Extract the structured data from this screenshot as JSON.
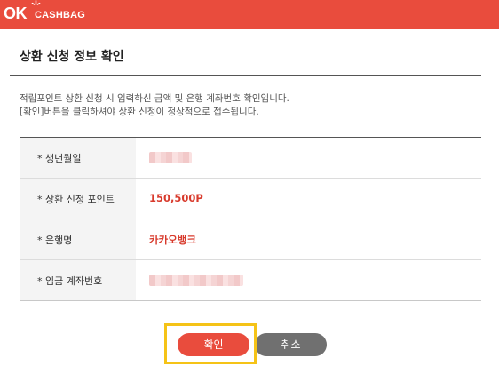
{
  "brand": {
    "ok": "OK",
    "cashbag": "CASHBAG",
    "color": "#e94c3d"
  },
  "page": {
    "title": "상환 신청 정보 확인",
    "description_line1": "적립포인트 상환 신청 시 입력하신 금액 및 은행 계좌번호 확인입니다.",
    "description_line2": "[확인]버튼을 클릭하셔야 상환 신청이 정상적으로 접수됩니다."
  },
  "rows": [
    {
      "label": "* 생년월일",
      "value": null,
      "masked": true
    },
    {
      "label": "* 상환 신청 포인트",
      "value": "150,500P",
      "masked": false
    },
    {
      "label": "* 은행명",
      "value": "카카오뱅크",
      "masked": false
    },
    {
      "label": "* 입금 계좌번호",
      "value": null,
      "masked": true
    }
  ],
  "buttons": {
    "confirm": "확인",
    "cancel": "취소"
  }
}
